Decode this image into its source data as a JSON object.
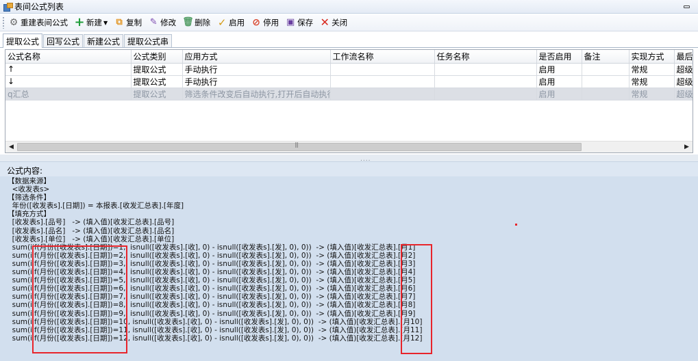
{
  "window": {
    "title": "表间公式列表"
  },
  "toolbar": {
    "rebuild": "重建表间公式",
    "new": "新建",
    "copy": "复制",
    "edit": "修改",
    "delete": "删除",
    "enable": "启用",
    "disable": "停用",
    "save": "保存",
    "close": "关闭"
  },
  "tabs": [
    "提取公式",
    "回写公式",
    "新建公式",
    "提取公式串"
  ],
  "grid": {
    "columns": [
      "公式名称",
      "公式类别",
      "应用方式",
      "工作流名称",
      "任务名称",
      "是否启用",
      "备注",
      "实现方式",
      "最后"
    ],
    "rows": [
      [
        "↑",
        "提取公式",
        "手动执行",
        "",
        "",
        "启用",
        "",
        "常规",
        "超级"
      ],
      [
        "↓",
        "提取公式",
        "手动执行",
        "",
        "",
        "启用",
        "",
        "常规",
        "超级"
      ],
      [
        "q汇总",
        "提取公式",
        "筛选条件改变后自动执行,打开后自动执行…",
        "",
        "",
        "启用",
        "",
        "常规",
        "超级"
      ]
    ]
  },
  "formula": {
    "label": "公式内容:",
    "lines": [
      "【数据来源】",
      "  <收发表s>",
      "【筛选条件】",
      "  年份([收发表s].[日期]) = 本报表.[收发汇总表].[年度]",
      "【填充方式】",
      "  [收发表s].[品号]   -> (填入值)[收发汇总表].[品号]",
      "  [收发表s].[品名]   -> (填入值)[收发汇总表].[品名]",
      "  [收发表s].[单位]   -> (填入值)[收发汇总表].[单位]",
      "  sum(iif(月份([收发表s].[日期])=1,  isnull([收发表s].[收], 0) - isnull([收发表s].[发], 0), 0))  -> (填入值)[收发汇总表].[月1]",
      "  sum(iif(月份([收发表s].[日期])=2,  isnull([收发表s].[收], 0) - isnull([收发表s].[发], 0), 0))  -> (填入值)[收发汇总表].[月2]",
      "  sum(iif(月份([收发表s].[日期])=3,  isnull([收发表s].[收], 0) - isnull([收发表s].[发], 0), 0))  -> (填入值)[收发汇总表].[月3]",
      "  sum(iif(月份([收发表s].[日期])=4,  isnull([收发表s].[收], 0) - isnull([收发表s].[发], 0), 0))  -> (填入值)[收发汇总表].[月4]",
      "  sum(iif(月份([收发表s].[日期])=5,  isnull([收发表s].[收], 0) - isnull([收发表s].[发], 0), 0))  -> (填入值)[收发汇总表].[月5]",
      "  sum(iif(月份([收发表s].[日期])=6,  isnull([收发表s].[收], 0) - isnull([收发表s].[发], 0), 0))  -> (填入值)[收发汇总表].[月6]",
      "  sum(iif(月份([收发表s].[日期])=7,  isnull([收发表s].[收], 0) - isnull([收发表s].[发], 0), 0))  -> (填入值)[收发汇总表].[月7]",
      "  sum(iif(月份([收发表s].[日期])=8,  isnull([收发表s].[收], 0) - isnull([收发表s].[发], 0), 0))  -> (填入值)[收发汇总表].[月8]",
      "  sum(iif(月份([收发表s].[日期])=9,  isnull([收发表s].[收], 0) - isnull([收发表s].[发], 0), 0))  -> (填入值)[收发汇总表].[月9]",
      "  sum(iif(月份([收发表s].[日期])=10, isnull([收发表s].[收], 0) - isnull([收发表s].[发], 0), 0))  -> (填入值)[收发汇总表].[月10]",
      "  sum(iif(月份([收发表s].[日期])=11, isnull([收发表s].[收], 0) - isnull([收发表s].[发], 0), 0))  -> (填入值)[收发汇总表].[月11]",
      "  sum(iif(月份([收发表s].[日期])=12, isnull([收发表s].[收], 0) - isnull([收发表s].[发], 0), 0))  -> (填入值)[收发汇总表].[月12]"
    ]
  },
  "colors": {
    "highlight": "#e8242a",
    "formula_bg": "#d2dfee",
    "add_icon": "#1f9d3a",
    "enable_icon": "#d49a16",
    "disable_icon": "#d9452c",
    "close_icon": "#d8291f"
  }
}
